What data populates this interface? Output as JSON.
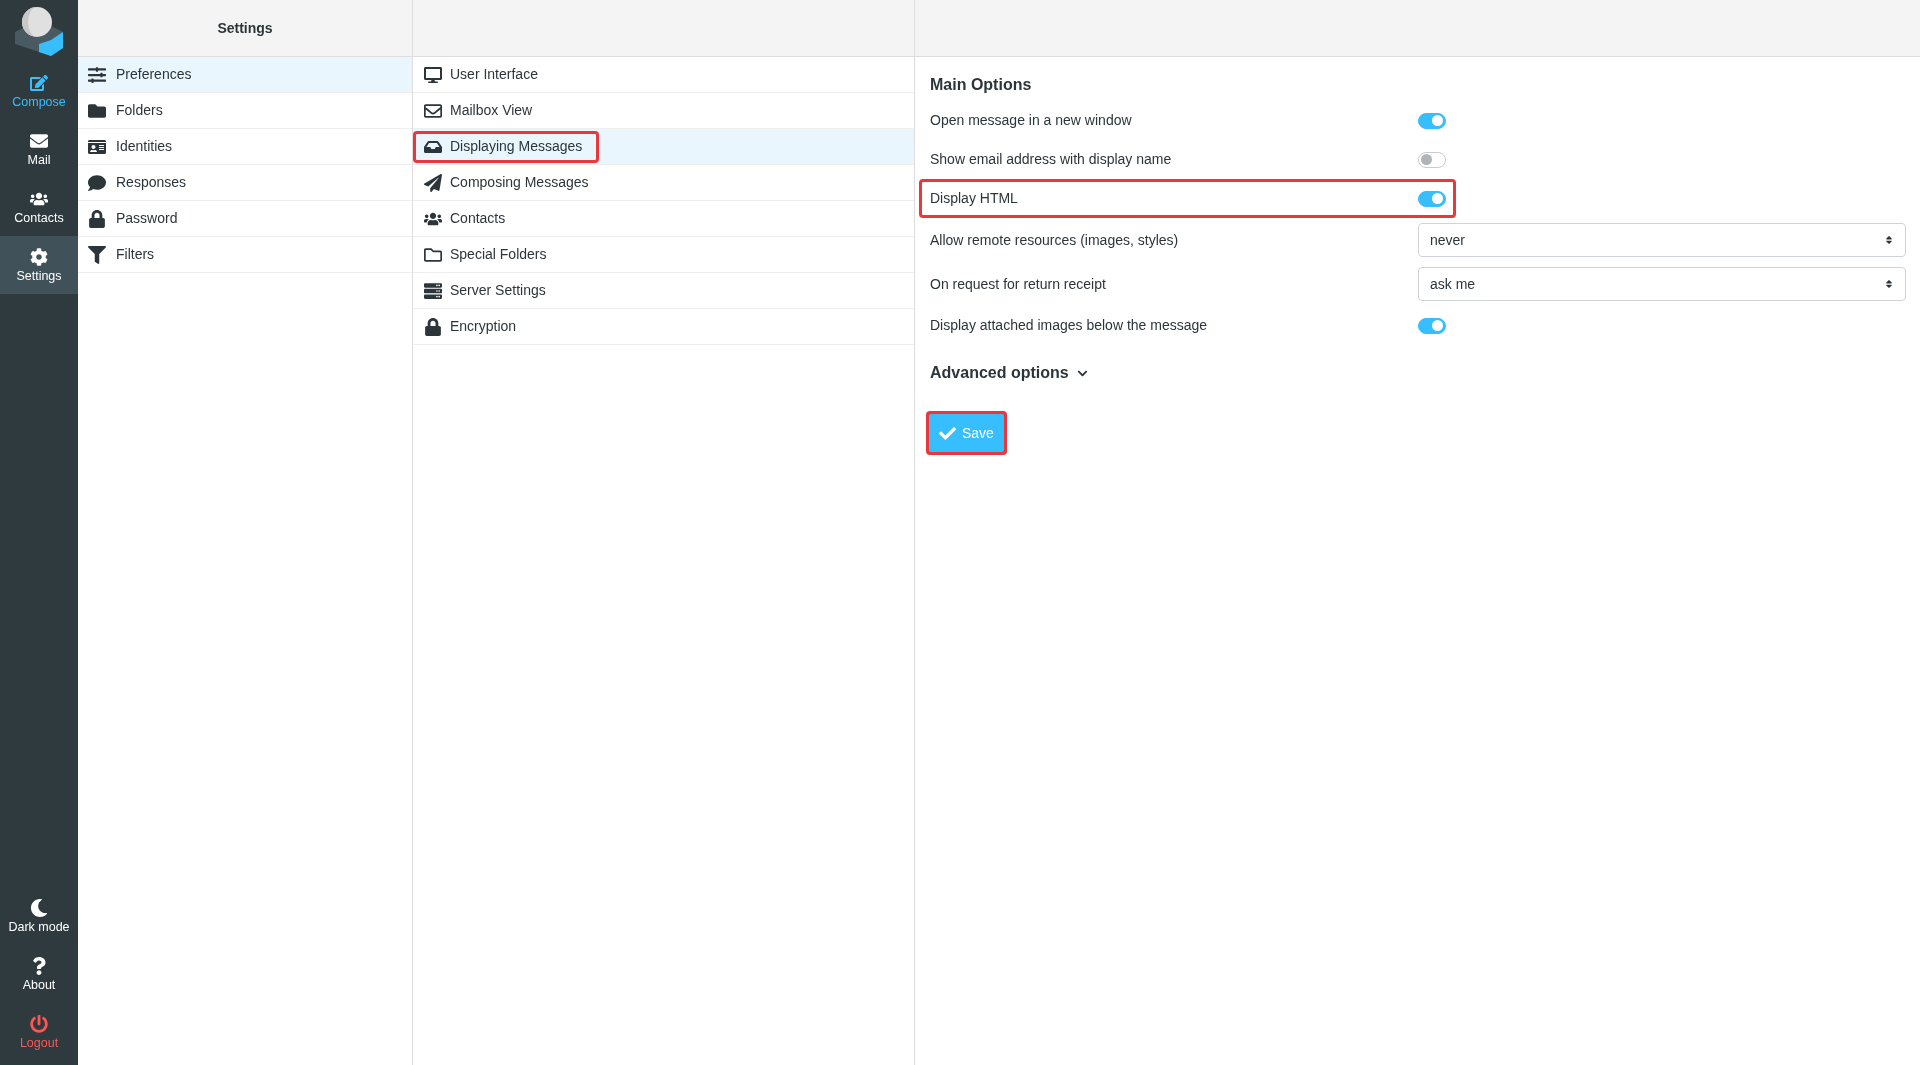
{
  "nav": {
    "top": [
      {
        "label": "Compose",
        "kind": "action",
        "selected": false
      },
      {
        "label": "Mail",
        "kind": "nav",
        "selected": false
      },
      {
        "label": "Contacts",
        "kind": "nav",
        "selected": false
      },
      {
        "label": "Settings",
        "kind": "nav",
        "selected": true
      }
    ],
    "bottom": [
      {
        "label": "Dark mode",
        "kind": "nav"
      },
      {
        "label": "About",
        "kind": "nav"
      },
      {
        "label": "Logout",
        "kind": "logout"
      }
    ]
  },
  "settings": {
    "title": "Settings",
    "items": [
      {
        "label": "Preferences",
        "selected": true
      },
      {
        "label": "Folders",
        "selected": false
      },
      {
        "label": "Identities",
        "selected": false
      },
      {
        "label": "Responses",
        "selected": false
      },
      {
        "label": "Password",
        "selected": false
      },
      {
        "label": "Filters",
        "selected": false
      }
    ]
  },
  "sections": [
    {
      "label": "User Interface",
      "selected": false,
      "highlighted": false
    },
    {
      "label": "Mailbox View",
      "selected": false,
      "highlighted": false
    },
    {
      "label": "Displaying Messages",
      "selected": true,
      "highlighted": true
    },
    {
      "label": "Composing Messages",
      "selected": false,
      "highlighted": false
    },
    {
      "label": "Contacts",
      "selected": false,
      "highlighted": false
    },
    {
      "label": "Special Folders",
      "selected": false,
      "highlighted": false
    },
    {
      "label": "Server Settings",
      "selected": false,
      "highlighted": false
    },
    {
      "label": "Encryption",
      "selected": false,
      "highlighted": false
    }
  ],
  "main_options": {
    "title": "Main Options",
    "options": [
      {
        "label": "Open message in a new window",
        "kind": "toggle",
        "on": true,
        "highlighted": false
      },
      {
        "label": "Show email address with display name",
        "kind": "toggle",
        "on": false,
        "highlighted": false
      },
      {
        "label": "Display HTML",
        "kind": "toggle",
        "on": true,
        "highlighted": true
      },
      {
        "label": "Allow remote resources (images, styles)",
        "kind": "select",
        "value": "never",
        "highlighted": false
      },
      {
        "label": "On request for return receipt",
        "kind": "select",
        "value": "ask me",
        "highlighted": false
      },
      {
        "label": "Display attached images below the message",
        "kind": "toggle",
        "on": true,
        "highlighted": false
      }
    ]
  },
  "advanced": {
    "label": "Advanced options",
    "expanded": false
  },
  "save_button": {
    "label": "Save",
    "highlighted": true
  }
}
